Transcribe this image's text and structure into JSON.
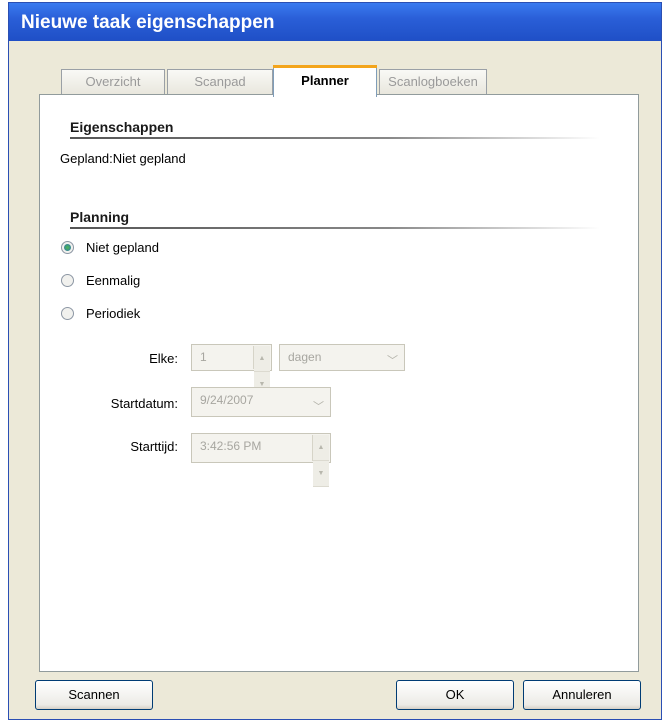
{
  "window": {
    "title": "Nieuwe taak eigenschappen"
  },
  "tabs": [
    {
      "label": "Overzicht"
    },
    {
      "label": "Scanpad"
    },
    {
      "label": "Planner"
    },
    {
      "label": "Scanlogboeken"
    }
  ],
  "properties": {
    "section_title": "Eigenschappen",
    "text": "Gepland:Niet gepland"
  },
  "planning": {
    "section_title": "Planning",
    "options": [
      {
        "label": "Niet gepland",
        "selected": true
      },
      {
        "label": "Eenmalig",
        "selected": false
      },
      {
        "label": "Periodiek",
        "selected": false
      }
    ],
    "every_label": "Elke:",
    "every_value": "1",
    "every_unit": "dagen",
    "startdate_label": "Startdatum:",
    "startdate_value": "9/24/2007",
    "starttime_label": "Starttijd:",
    "starttime_value": "3:42:56 PM"
  },
  "buttons": {
    "scan": "Scannen",
    "ok": "OK",
    "cancel": "Annuleren"
  }
}
